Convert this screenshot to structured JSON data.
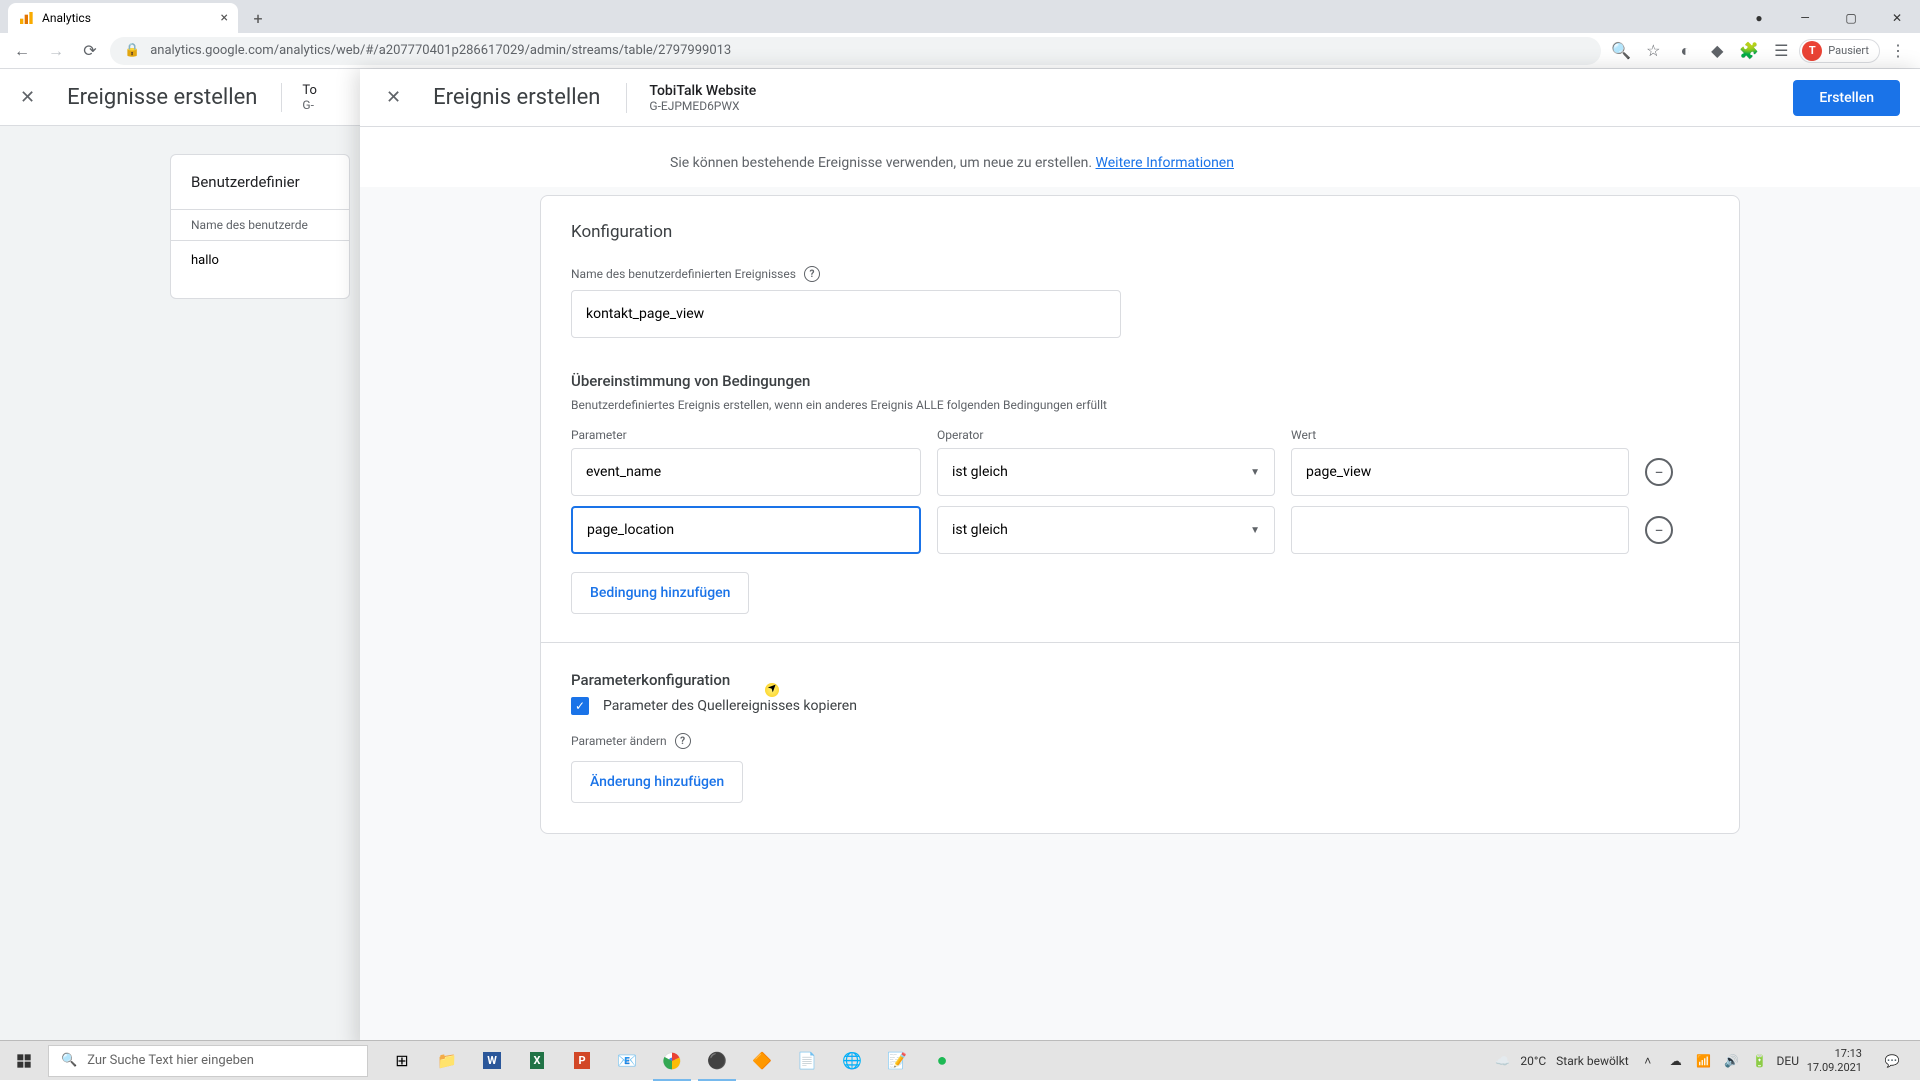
{
  "browser": {
    "tab_title": "Analytics",
    "url": "analytics.google.com/analytics/web/#/a207770401p286617029/admin/streams/table/2797999013",
    "profile_status": "Pausiert",
    "profile_initial": "T"
  },
  "bg_panel": {
    "title": "Ereignisse erstellen",
    "stream_title": "To",
    "stream_sub": "G-",
    "card_title": "Benutzerdefinier",
    "card_subhead": "Name des benutzerde",
    "card_row": "hallo"
  },
  "modal": {
    "title": "Ereignis erstellen",
    "stream_name": "TobiTalk Website",
    "stream_id": "G-EJPMED6PWX",
    "create_btn": "Erstellen",
    "info_text": "Sie können bestehende Ereignisse verwenden, um neue zu erstellen. ",
    "info_link": "Weitere Informationen",
    "config": {
      "heading": "Konfiguration",
      "name_label": "Name des benutzerdefinierten Ereignisses",
      "name_value": "kontakt_page_view",
      "conditions": {
        "heading": "Übereinstimmung von Bedingungen",
        "desc": "Benutzerdefiniertes Ereignis erstellen, wenn ein anderes Ereignis ALLE folgenden Bedingungen erfüllt",
        "headers": {
          "param": "Parameter",
          "operator": "Operator",
          "value": "Wert"
        },
        "rows": [
          {
            "param": "event_name",
            "operator": "ist gleich",
            "value": "page_view",
            "focused": false
          },
          {
            "param": "page_location",
            "operator": "ist gleich",
            "value": "",
            "focused": true
          }
        ],
        "add_btn": "Bedingung hinzufügen"
      },
      "param_config": {
        "heading": "Parameterkonfiguration",
        "copy_label": "Parameter des Quellereignisses kopieren",
        "modify_label": "Parameter ändern",
        "add_change_btn": "Änderung hinzufügen"
      }
    }
  },
  "taskbar": {
    "search_placeholder": "Zur Suche Text hier eingeben",
    "weather_temp": "20°C",
    "weather_desc": "Stark bewölkt",
    "time": "17:13",
    "date": "17.09.2021"
  }
}
